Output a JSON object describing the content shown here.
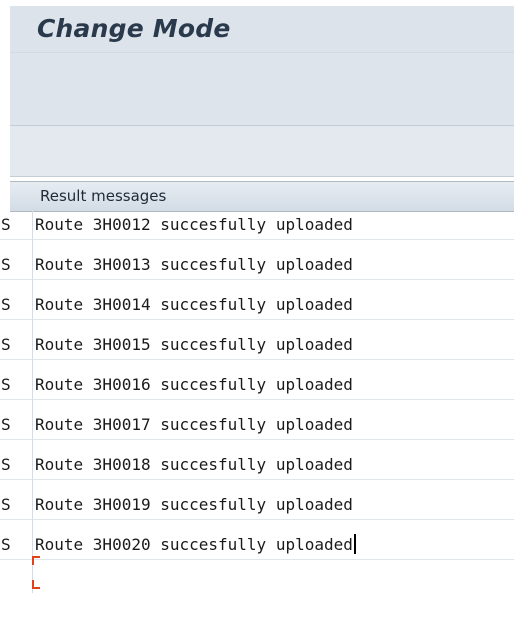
{
  "header": {
    "title": "Change Mode"
  },
  "results": {
    "header_label": "Result messages",
    "rows": [
      {
        "status": "S",
        "message": "Route 3H0012 succesfully uploaded"
      },
      {
        "status": "S",
        "message": "Route 3H0013 succesfully uploaded"
      },
      {
        "status": "S",
        "message": "Route 3H0014 succesfully uploaded"
      },
      {
        "status": "S",
        "message": "Route 3H0015 succesfully uploaded"
      },
      {
        "status": "S",
        "message": "Route 3H0016 succesfully uploaded"
      },
      {
        "status": "S",
        "message": "Route 3H0017 succesfully uploaded"
      },
      {
        "status": "S",
        "message": "Route 3H0018 succesfully uploaded"
      },
      {
        "status": "S",
        "message": "Route 3H0019 succesfully uploaded"
      },
      {
        "status": "S",
        "message": "Route 3H0020 succesfully uploaded"
      }
    ]
  },
  "colors": {
    "title_text": "#2a3a4c",
    "header_bg": "#dce3ea",
    "selection_marker": "#e2411e"
  }
}
